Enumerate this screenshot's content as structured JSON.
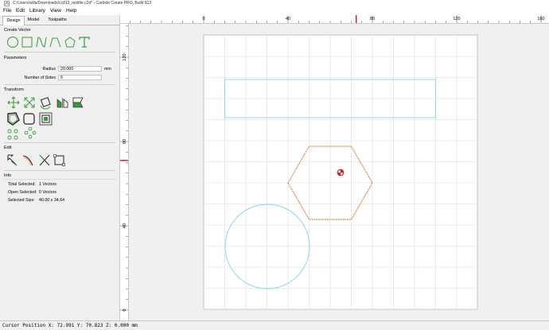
{
  "window": {
    "title": "C:/Users/willa/Downloads/cc813_testfile.c2d* - Carbide Create PRO, Build 813"
  },
  "menu": [
    {
      "label": "File"
    },
    {
      "label": "Edit"
    },
    {
      "label": "Library"
    },
    {
      "label": "View"
    },
    {
      "label": "Help"
    }
  ],
  "tabs": [
    {
      "label": "Design"
    },
    {
      "label": "Model"
    },
    {
      "label": "Toolpaths"
    }
  ],
  "create_vector": {
    "title": "Create Vector",
    "tools": [
      "circle-tool-icon",
      "rectangle-tool-icon",
      "curve-tool-icon",
      "polyline-tool-icon",
      "polygon-tool-icon",
      "text-tool-icon"
    ]
  },
  "parameters": {
    "title": "Parameters",
    "radius_label": "Radius",
    "radius_value": "20.000",
    "radius_unit": "mm",
    "sides_label": "Number of Sides",
    "sides_value": "6"
  },
  "transform": {
    "title": "Transform"
  },
  "edit": {
    "title": "Edit"
  },
  "info": {
    "title": "Info",
    "total_selected_label": "Total Selected:",
    "total_selected_value": "1 Vectors",
    "open_selected_label": "Open Selected:",
    "open_selected_value": "0 Vectors",
    "selected_size_label": "Selected Size:",
    "selected_size_value": "40.00 x 34.64"
  },
  "ruler": {
    "x_labels": [
      "0",
      "40",
      "80",
      "120",
      "160"
    ],
    "y_labels": [
      "120",
      "80",
      "40",
      "0"
    ]
  },
  "status": {
    "cursor": "Cursor Position X: 72.991 Y: 70.823 Z: 0.000 mm"
  },
  "colors": {
    "accent_green": "#3a9a3a",
    "vector_blue": "#7fd3ef",
    "selected_orange": "#e08a50",
    "marker_red": "#e02020",
    "grid": "#dcdcdc"
  }
}
